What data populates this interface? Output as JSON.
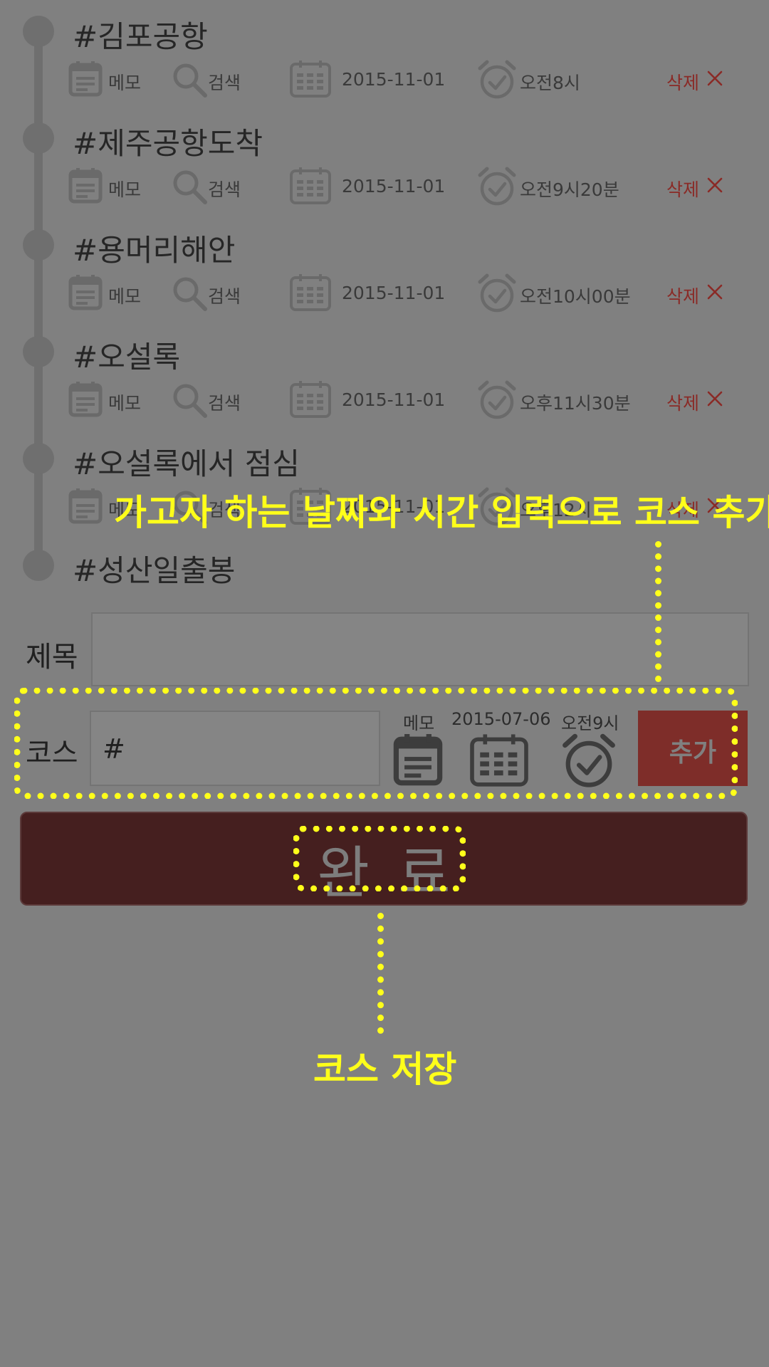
{
  "course_items": [
    {
      "title": "#김포공항",
      "memo": "메모",
      "search": "검색",
      "date": "2015-11-01",
      "time": "오전8시",
      "delete": "삭제"
    },
    {
      "title": "#제주공항도착",
      "memo": "메모",
      "search": "검색",
      "date": "2015-11-01",
      "time": "오전9시20분",
      "delete": "삭제"
    },
    {
      "title": "#용머리해안",
      "memo": "메모",
      "search": "검색",
      "date": "2015-11-01",
      "time": "오전10시00분",
      "delete": "삭제"
    },
    {
      "title": "#오설록",
      "memo": "메모",
      "search": "검색",
      "date": "2015-11-01",
      "time": "오후11시30분",
      "delete": "삭제"
    },
    {
      "title": "#오설록에서 점심",
      "memo": "메모",
      "search": "검색",
      "date": "2015-11-01",
      "time": "오후12시",
      "delete": "삭제"
    },
    {
      "title": "#성산일출봉"
    }
  ],
  "form": {
    "title_label": "제목",
    "title_value": "",
    "course_label": "코스",
    "course_value": "#",
    "memo_label": "메모",
    "date_value": "2015-07-06",
    "time_value": "오전9시",
    "add_label": "추가"
  },
  "done_label": "완료",
  "annotations": {
    "add_course": "가고자 하는 날짜와 시간 입력으로 코스 추가",
    "save_course": "코스 저장"
  },
  "icons": {
    "memo": "memo-icon",
    "search": "search-icon",
    "calendar": "calendar-icon",
    "alarm": "alarm-clock-icon",
    "delete": "close-icon"
  },
  "colors": {
    "background": "#808080",
    "delete": "#8a2a26",
    "add_button": "#7e2d29",
    "done_button": "#451f1f",
    "annotation": "#ffff1a"
  }
}
